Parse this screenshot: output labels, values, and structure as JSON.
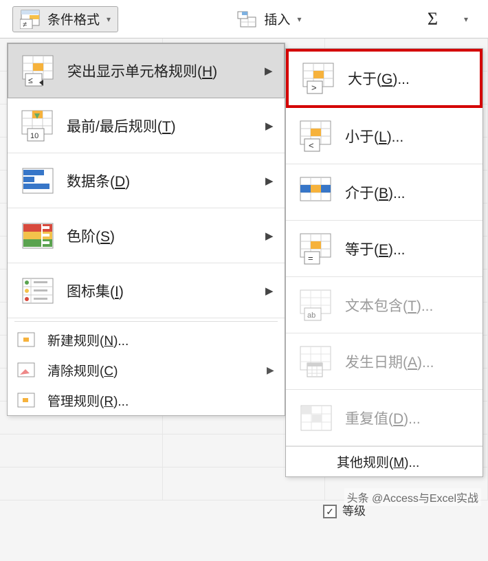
{
  "toolbar": {
    "cond_format": "条件格式",
    "insert": "插入",
    "sum": "Σ"
  },
  "menu_left": {
    "highlight_rules": {
      "label_pre": "突出显示单元格规则(",
      "hotkey": "H",
      "label_post": ")"
    },
    "top_bottom": {
      "label_pre": "最前/最后规则(",
      "hotkey": "T",
      "label_post": ")"
    },
    "data_bars": {
      "label_pre": "数据条(",
      "hotkey": "D",
      "label_post": ")"
    },
    "color_scales": {
      "label_pre": "色阶(",
      "hotkey": "S",
      "label_post": ")"
    },
    "icon_sets": {
      "label_pre": "图标集(",
      "hotkey": "I",
      "label_post": ")"
    },
    "new_rule": {
      "label_pre": "新建规则(",
      "hotkey": "N",
      "label_post": ")..."
    },
    "clear_rules": {
      "label_pre": "清除规则(",
      "hotkey": "C",
      "label_post": ")"
    },
    "manage_rules": {
      "label_pre": "管理规则(",
      "hotkey": "R",
      "label_post": ")..."
    }
  },
  "menu_right": {
    "greater": {
      "label_pre": "大于(",
      "hotkey": "G",
      "label_post": ")..."
    },
    "less": {
      "label_pre": "小于(",
      "hotkey": "L",
      "label_post": ")..."
    },
    "between": {
      "label_pre": "介于(",
      "hotkey": "B",
      "label_post": ")..."
    },
    "equal": {
      "label_pre": "等于(",
      "hotkey": "E",
      "label_post": ")..."
    },
    "text_has": {
      "label_pre": "文本包含(",
      "hotkey": "T",
      "label_post": ")..."
    },
    "date_occ": {
      "label_pre": "发生日期(",
      "hotkey": "A",
      "label_post": ")..."
    },
    "dup_vals": {
      "label_pre": "重复值(",
      "hotkey": "D",
      "label_post": ")..."
    },
    "more": {
      "label_pre": "其他规则(",
      "hotkey": "M",
      "label_post": ")..."
    }
  },
  "watermark": "头条 @Access与Excel实战",
  "footer_check_label": "等级"
}
